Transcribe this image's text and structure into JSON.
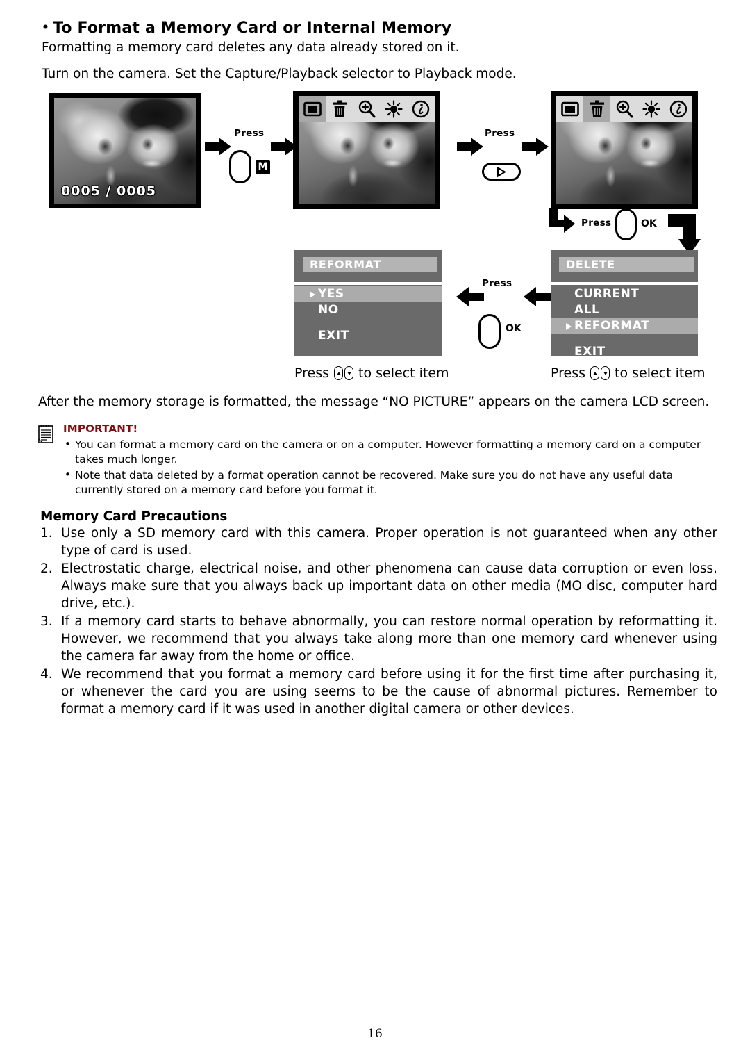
{
  "heading": {
    "bullet": "•",
    "title": "To Format a Memory Card or Internal Memory"
  },
  "intro": {
    "line1": "Formatting a memory card deletes any data already stored on it.",
    "line2": "Turn on the camera.  Set the Capture/Playback selector to Playback mode."
  },
  "diagram": {
    "lcd1": {
      "counter": "0005 / 0005"
    },
    "icon_bar": {
      "icons": [
        "display-icon",
        "trash-icon",
        "zoom-in-icon",
        "brightness-icon",
        "info-icon"
      ],
      "lcd2_selected_index": 0,
      "lcd3_selected_index": 1
    },
    "step1": {
      "press_label": "Press",
      "button_label": "M"
    },
    "step2": {
      "press_label": "Press",
      "button_icon": "play-icon"
    },
    "step3": {
      "press_label": "Press",
      "ok_label": "OK"
    },
    "step4": {
      "press_label": "Press",
      "ok_label": "OK"
    },
    "reformat_menu": {
      "title": "REFORMAT",
      "items": [
        {
          "label": "YES",
          "selected": true,
          "gap": false
        },
        {
          "label": "NO",
          "selected": false,
          "gap": false
        },
        {
          "label": "EXIT",
          "selected": false,
          "gap": true
        }
      ]
    },
    "delete_menu": {
      "title": "DELETE",
      "items": [
        {
          "label": "CURRENT",
          "selected": false,
          "gap": false
        },
        {
          "label": "ALL",
          "selected": false,
          "gap": false
        },
        {
          "label": "REFORMAT",
          "selected": true,
          "gap": false
        },
        {
          "label": "EXIT",
          "selected": false,
          "gap": true
        }
      ]
    },
    "caption_left": {
      "press": "Press",
      "rest": "to select item"
    },
    "caption_right": {
      "press": "Press",
      "rest": "to select item"
    }
  },
  "after_format_note": "After the memory storage is formatted, the message “NO PICTURE” appears on the camera LCD screen.",
  "important": {
    "heading": "IMPORTANT!",
    "heading_color": "#7b1010",
    "icon": "notepad-icon",
    "bullets": [
      "You can format a memory card on the camera or on a computer.  However formatting a memory card on a computer takes much longer.",
      "Note that data deleted by a format operation cannot be recovered.  Make sure you do not have any useful data currently stored on a memory card before you format it."
    ]
  },
  "precautions": {
    "title": "Memory Card Precautions",
    "items": [
      {
        "number": "1.",
        "text": "Use only a SD memory card with this camera.  Proper operation is not guaranteed when any other type of card is used."
      },
      {
        "number": "2.",
        "text": "Electrostatic charge, electrical noise, and other phenomena can cause data corruption or even loss.  Always make sure that you always back up important data on other media (MO disc, computer hard drive, etc.)."
      },
      {
        "number": "3.",
        "text": "If a memory card starts to behave abnormally, you can restore normal operation by reformatting it.  However, we recommend that you always take along more than one memory card whenever using the camera far away from the home or office."
      },
      {
        "number": "4.",
        "text": "We recommend that you format a memory card before using it for the first time after purchasing it, or whenever the card you are using seems to be the cause of abnormal pictures.  Remember to format a memory card if it was used in another digital camera or other devices."
      }
    ]
  },
  "page_number": "16"
}
